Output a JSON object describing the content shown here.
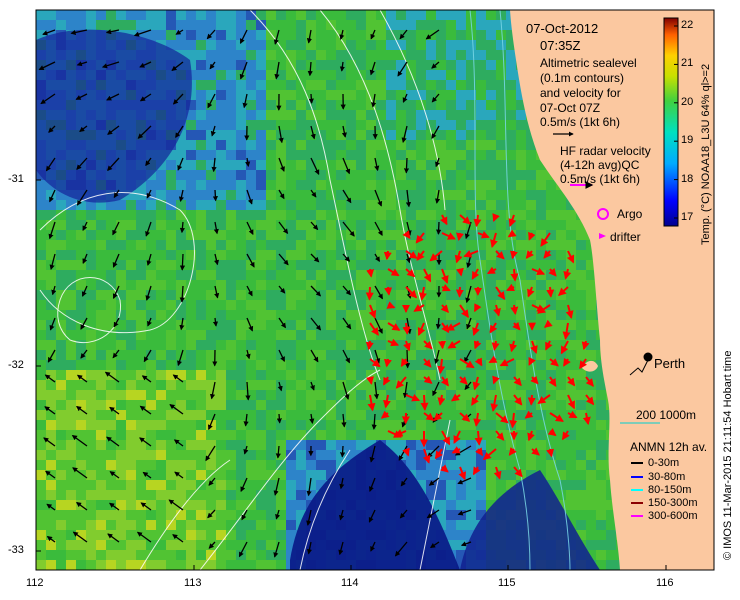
{
  "map": {
    "date": "07-Oct-2012",
    "time": "07:35Z",
    "sealevel_text": [
      "Altimetric sealevel",
      "(0.1m contours)",
      "and velocity for",
      "07-Oct 07Z",
      "0.5m/s (1kt 6h)"
    ],
    "hf_text": [
      "HF radar velocity",
      "(4-12h avg)QC",
      "0.5m/s (1kt 6h)"
    ],
    "argo_label": "Argo",
    "drifter_label": "drifter",
    "city_label": "Perth",
    "depth_label": "200  1000m",
    "anmn_title": "ANMN 12h av.",
    "anmn_items": [
      {
        "label": "0-30m",
        "color": "#000000"
      },
      {
        "label": "30-80m",
        "color": "#0000ff"
      },
      {
        "label": "80-150m",
        "color": "#00ffff"
      },
      {
        "label": "150-300m",
        "color": "#8b0000"
      },
      {
        "label": "300-600m",
        "color": "#ff00ff"
      }
    ],
    "credit": "© IMOS 11-Mar-2015 21:11:54 Hobart time",
    "x_ticks": [
      "112",
      "113",
      "114",
      "115",
      "116"
    ],
    "y_ticks": [
      "-31",
      "-32",
      "-33"
    ],
    "colorbar": {
      "title": "Temp. (°C) NOAA18_L3U 64% ql>=2",
      "ticks": [
        "17",
        "18",
        "19",
        "20",
        "21",
        "22"
      ]
    },
    "colors": {
      "land": "#fbc8a0",
      "ocean_deep": "#06127a",
      "ocean_mid": "#1565c8",
      "ocean_warm": "#35b030",
      "hf_arrow": "#ff0000",
      "argo": "#ff00ff",
      "drifter": "#ff00ff"
    }
  }
}
